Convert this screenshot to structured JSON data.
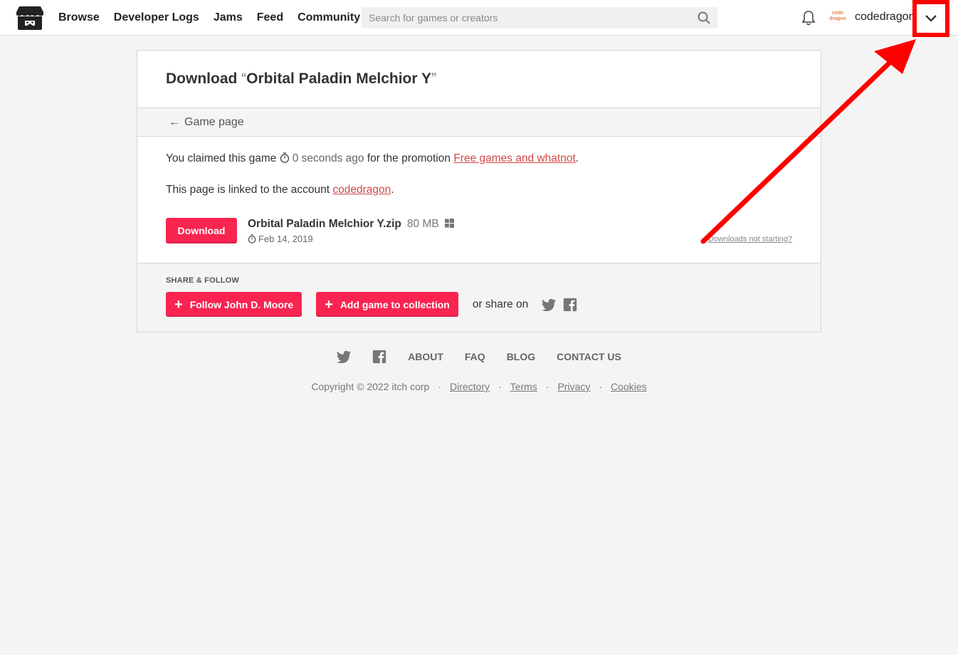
{
  "header": {
    "nav": [
      "Browse",
      "Developer Logs",
      "Jams",
      "Feed",
      "Community"
    ],
    "search_placeholder": "Search for games or creators",
    "avatar_text": "code dragon",
    "username": "codedragon"
  },
  "card": {
    "title_prefix": "Download ",
    "quote_open": "“",
    "game_title": "Orbital Paladin Melchior Y",
    "quote_close": "”",
    "back_arrow": "←",
    "back_label": "Game page",
    "claim_pre": "You claimed this game ",
    "claim_time": "0 seconds ago",
    "claim_mid": " for the promotion ",
    "promotion": "Free games and whatnot",
    "claim_end": ".",
    "linked_pre": "This page is linked to the account ",
    "linked_account": "codedragon",
    "linked_end": ".",
    "download_label": "Download",
    "file_name": "Orbital Paladin Melchior Y.zip",
    "file_size": "80 MB",
    "file_date": "Feb 14, 2019",
    "not_starting": "Downloads not starting?",
    "share_label": "SHARE & FOLLOW",
    "follow_label": "Follow John D. Moore",
    "collection_label": "Add game to collection",
    "share_on": "or share on"
  },
  "footer": {
    "links": [
      "ABOUT",
      "FAQ",
      "BLOG",
      "CONTACT US"
    ],
    "copyright": "Copyright © 2022 itch corp",
    "legal": [
      "Directory",
      "Terms",
      "Privacy",
      "Cookies"
    ]
  },
  "colors": {
    "accent": "#fa2450",
    "link": "#d14848",
    "annotation": "#ff0000"
  },
  "icons": [
    "itchio-logo-icon",
    "search-icon",
    "bell-icon",
    "chevron-down-icon",
    "clock-icon",
    "windows-icon",
    "plus-icon",
    "twitter-icon",
    "facebook-icon"
  ]
}
